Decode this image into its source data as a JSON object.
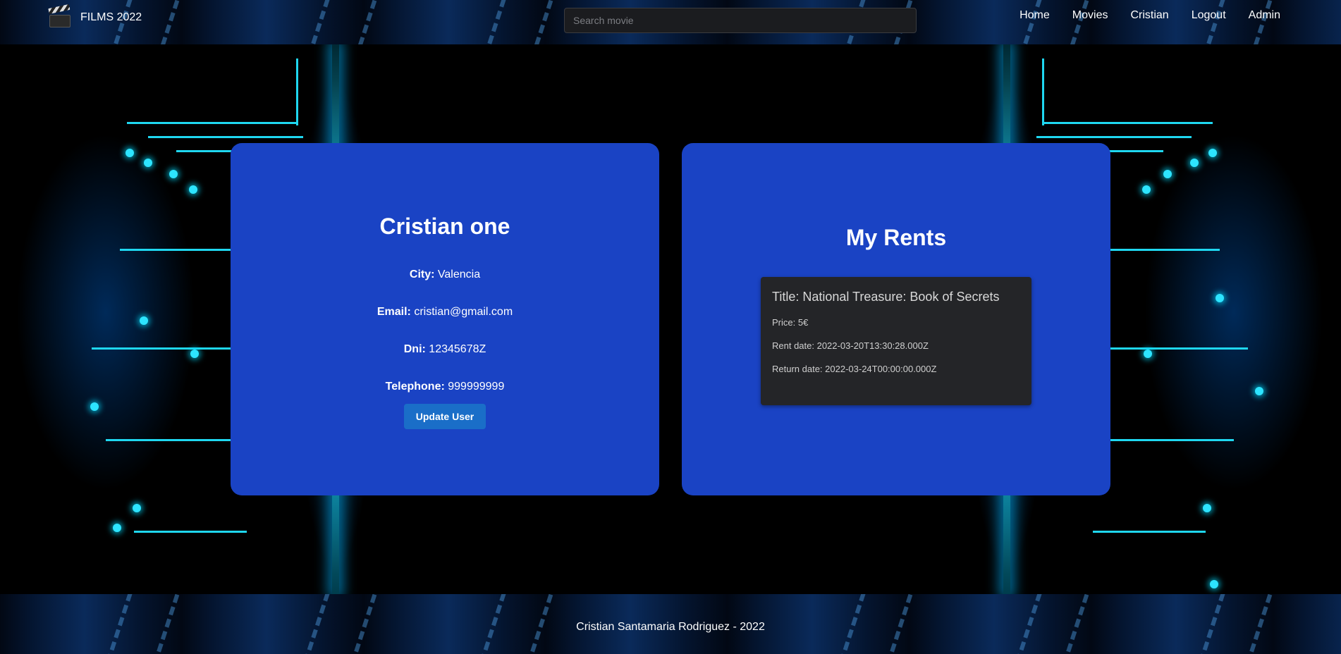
{
  "header": {
    "brand": "FILMS 2022",
    "search_placeholder": "Search movie",
    "nav": [
      "Home",
      "Movies",
      "Cristian",
      "Logout",
      "Admin"
    ]
  },
  "profile": {
    "name": "Cristian one",
    "fields": [
      {
        "label": "City:",
        "value": "Valencia"
      },
      {
        "label": "Email:",
        "value": "cristian@gmail.com"
      },
      {
        "label": "Dni:",
        "value": "12345678Z"
      },
      {
        "label": "Telephone:",
        "value": "999999999"
      }
    ],
    "update_button": "Update User"
  },
  "rents": {
    "title": "My Rents",
    "items": [
      {
        "title": "Title: National Treasure: Book of Secrets",
        "price": "Price: 5€",
        "rent_date": "Rent date: 2022-03-20T13:30:28.000Z",
        "return_date": "Return date: 2022-03-24T00:00:00.000Z"
      }
    ]
  },
  "footer": {
    "text": "Cristian Santamaria Rodriguez - 2022"
  },
  "colors": {
    "card_bg": "#1a43c4",
    "rent_card_bg": "#242528",
    "button_bg": "#1a6ec8",
    "circuit_glow": "#2de4ff"
  }
}
